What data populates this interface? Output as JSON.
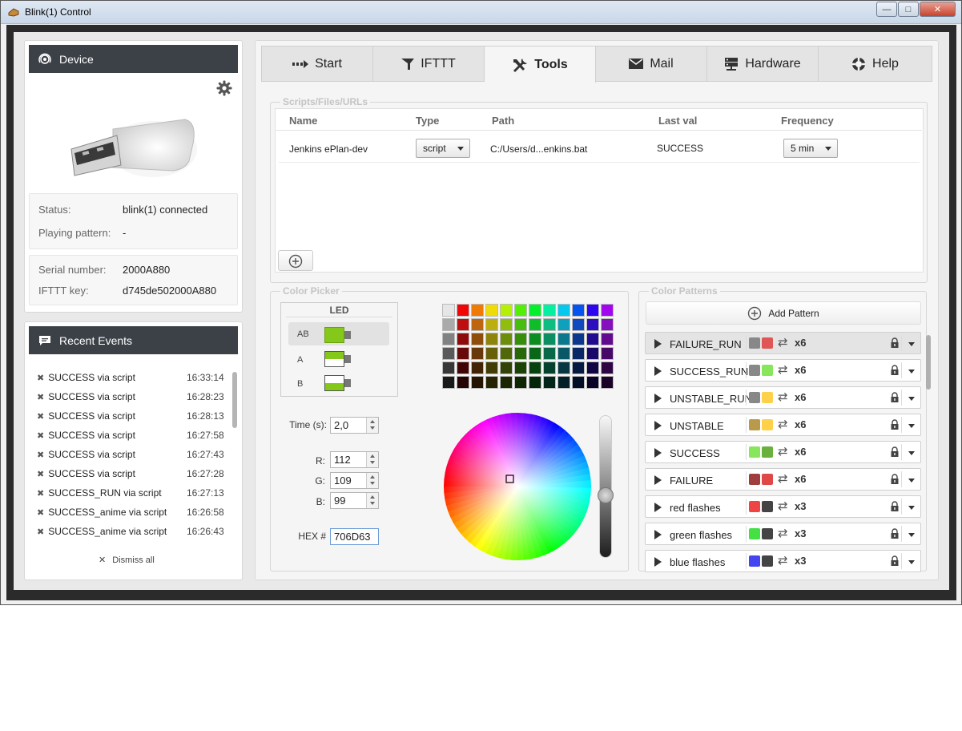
{
  "window": {
    "title": "Blink(1) Control",
    "min": "—",
    "max": "□",
    "close": "✕"
  },
  "device": {
    "header": "Device",
    "status_label": "Status:",
    "status_value": "blink(1) connected",
    "playing_label": "Playing pattern:",
    "playing_value": "-",
    "serial_label": "Serial number:",
    "serial_value": "2000A880",
    "ifttt_label": "IFTTT key:",
    "ifttt_value": "d745de502000A880"
  },
  "events": {
    "header": "Recent Events",
    "items": [
      {
        "text": "SUCCESS via script",
        "time": "16:33:14"
      },
      {
        "text": "SUCCESS via script",
        "time": "16:28:23"
      },
      {
        "text": "SUCCESS via script",
        "time": "16:28:13"
      },
      {
        "text": "SUCCESS via script",
        "time": "16:27:58"
      },
      {
        "text": "SUCCESS via script",
        "time": "16:27:43"
      },
      {
        "text": "SUCCESS via script",
        "time": "16:27:28"
      },
      {
        "text": "SUCCESS_RUN via script",
        "time": "16:27:13"
      },
      {
        "text": "SUCCESS_anime via script",
        "time": "16:26:58"
      },
      {
        "text": "SUCCESS_anime via script",
        "time": "16:26:43"
      }
    ],
    "dismiss": "Dismiss all"
  },
  "tabs": [
    {
      "label": "Start",
      "icon": "start-icon"
    },
    {
      "label": "IFTTT",
      "icon": "ifttt-icon"
    },
    {
      "label": "Tools",
      "icon": "tools-icon"
    },
    {
      "label": "Mail",
      "icon": "mail-icon"
    },
    {
      "label": "Hardware",
      "icon": "hardware-icon"
    },
    {
      "label": "Help",
      "icon": "help-icon"
    }
  ],
  "active_tab": "Tools",
  "scripts": {
    "title": "Scripts/Files/URLs",
    "headers": {
      "name": "Name",
      "type": "Type",
      "path": "Path",
      "last": "Last val",
      "freq": "Frequency"
    },
    "rows": [
      {
        "name": "Jenkins ePlan-dev",
        "type": "script",
        "path": "C:/Users/d...enkins.bat",
        "last": "SUCCESS",
        "freq": "5 min"
      }
    ]
  },
  "picker": {
    "title": "Color Picker",
    "led_header": "LED",
    "leds": [
      "AB",
      "A",
      "B"
    ],
    "time_label": "Time (s):",
    "time_value": "2,0",
    "r_label": "R:",
    "r_value": "112",
    "g_label": "G:",
    "g_value": "109",
    "b_label": "B:",
    "b_value": "99",
    "hex_label": "HEX #",
    "hex_value": "706D63",
    "accent_color": "#84c81a"
  },
  "patterns": {
    "title": "Color Patterns",
    "add": "Add Pattern",
    "items": [
      {
        "name": "FAILURE_RUN",
        "c1": "#888888",
        "c2": "#e05555",
        "count": "x6"
      },
      {
        "name": "SUCCESS_RUN",
        "c1": "#888888",
        "c2": "#88e65a",
        "count": "x6"
      },
      {
        "name": "UNSTABLE_RUN",
        "c1": "#888888",
        "c2": "#ffd04a",
        "count": "x6"
      },
      {
        "name": "UNSTABLE",
        "c1": "#b89a4a",
        "c2": "#ffd04a",
        "count": "x6"
      },
      {
        "name": "SUCCESS",
        "c1": "#88e65a",
        "c2": "#6ab03c",
        "count": "x6"
      },
      {
        "name": "FAILURE",
        "c1": "#a03c3c",
        "c2": "#e04848",
        "count": "x6"
      },
      {
        "name": "red flashes",
        "c1": "#f04444",
        "c2": "#444444",
        "count": "x3"
      },
      {
        "name": "green flashes",
        "c1": "#44e044",
        "c2": "#444444",
        "count": "x3"
      },
      {
        "name": "blue flashes",
        "c1": "#4444f0",
        "c2": "#444444",
        "count": "x3"
      }
    ]
  }
}
